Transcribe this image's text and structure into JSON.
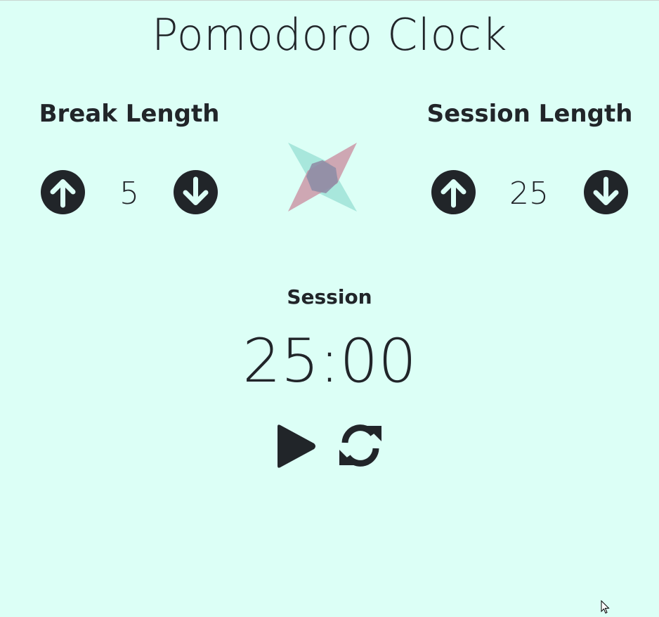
{
  "app": {
    "title": "Pomodoro Clock"
  },
  "break": {
    "label": "Break Length",
    "value": "5",
    "increment_icon": "arrow-circle-up-icon",
    "decrement_icon": "arrow-circle-down-icon"
  },
  "session": {
    "label": "Session Length",
    "value": "25",
    "increment_icon": "arrow-circle-up-icon",
    "decrement_icon": "arrow-circle-down-icon"
  },
  "timer": {
    "label": "Session",
    "time_left": "25:00",
    "start_icon": "play-icon",
    "reset_icon": "sync-icon"
  },
  "colors": {
    "background": "#dcfff6",
    "text": "#212529",
    "logo_teal": "#9fe3d7",
    "logo_rose": "#c98a9c",
    "logo_center": "#8f8ea6"
  }
}
